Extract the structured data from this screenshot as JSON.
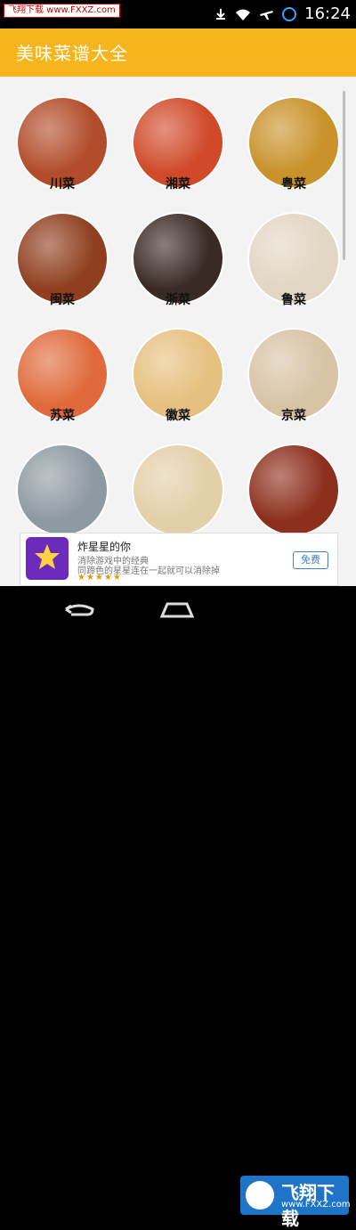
{
  "status": {
    "watermark_top": "飞翔下载 www.FXXZ.com",
    "time": "16:24",
    "icons": [
      "download-icon",
      "wifi-icon",
      "airplane-icon",
      "sync-icon"
    ]
  },
  "app": {
    "title": "美味菜谱大全"
  },
  "categories": [
    {
      "name": "川菜",
      "color": "#b24c2a"
    },
    {
      "name": "湘菜",
      "color": "#d04a2a"
    },
    {
      "name": "粤菜",
      "color": "#c9922a"
    },
    {
      "name": "闽菜",
      "color": "#8f3f1f"
    },
    {
      "name": "浙菜",
      "color": "#3a2a25"
    },
    {
      "name": "鲁菜",
      "color": "#e2d6c4"
    },
    {
      "name": "苏菜",
      "color": "#e06a3b"
    },
    {
      "name": "徽菜",
      "color": "#e6c07f"
    },
    {
      "name": "京菜",
      "color": "#d8c3a5"
    },
    {
      "name": "",
      "color": "#8e9aa1"
    },
    {
      "name": "",
      "color": "#e3cfa8"
    },
    {
      "name": "",
      "color": "#8d2f1d"
    }
  ],
  "ad": {
    "title": "炸星星的你",
    "line1": "消除游戏中的经典",
    "line2": "同蹄色的星星连在一起就可以消除掉",
    "stars": "★★★★★",
    "button": "免费"
  },
  "bottom_watermark": {
    "text": "飞翔下载",
    "url": "www.FXXZ.com"
  }
}
